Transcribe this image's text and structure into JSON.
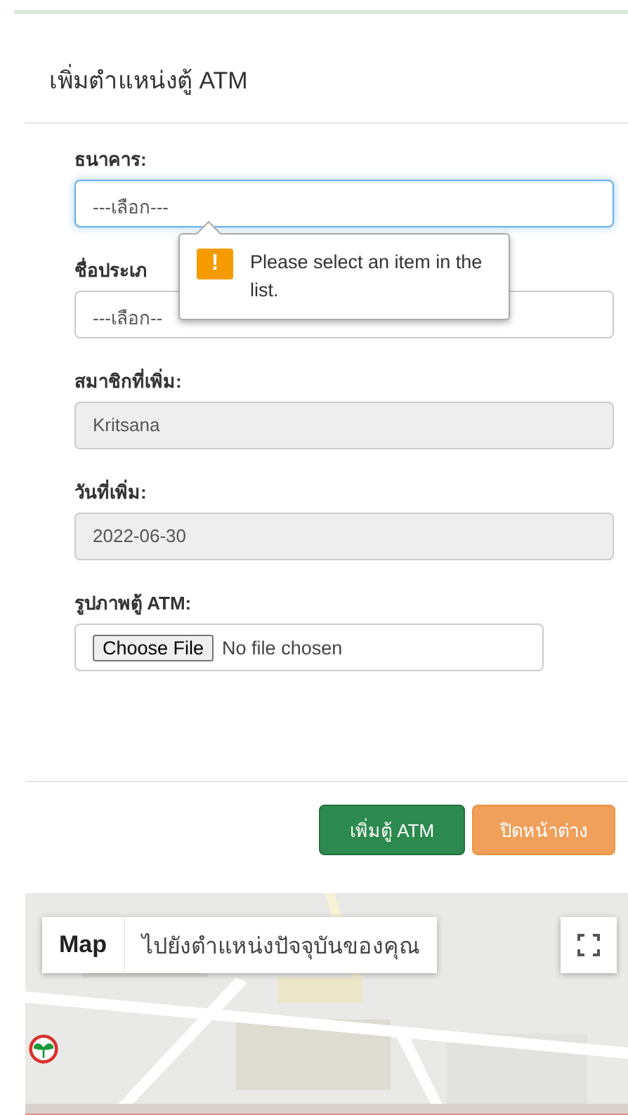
{
  "modal": {
    "title": "เพิ่มตำแหน่งตู้ ATM"
  },
  "fields": [
    {
      "kind": "select",
      "label": "ธนาคาร:",
      "value": "---เลือก---",
      "focused": true,
      "disabled": false
    },
    {
      "kind": "select",
      "label": "ชื่อประเภ",
      "value": "---เลือก--",
      "focused": false,
      "disabled": false
    },
    {
      "kind": "text",
      "label": "สมาชิกที่เพิ่ม:",
      "value": "Kritsana",
      "focused": false,
      "disabled": true
    },
    {
      "kind": "text",
      "label": "วันที่เพิ่ม:",
      "value": "2022-06-30",
      "focused": false,
      "disabled": true
    },
    {
      "kind": "file",
      "label": "รูปภาพตู้ ATM:",
      "button": "Choose File",
      "value": "No file chosen",
      "focused": false,
      "disabled": false
    }
  ],
  "tooltip": {
    "icon": "!",
    "text": "Please select an item in the list."
  },
  "buttons": [
    {
      "label": "เพิ่มตู้ ATM",
      "kind": "primary"
    },
    {
      "label": "ปิดหน้าต่าง",
      "kind": "warning"
    }
  ],
  "map": {
    "type_button": "Map",
    "location_button": "ไปยังตำแหน่งปัจจุบันของคุณ"
  }
}
